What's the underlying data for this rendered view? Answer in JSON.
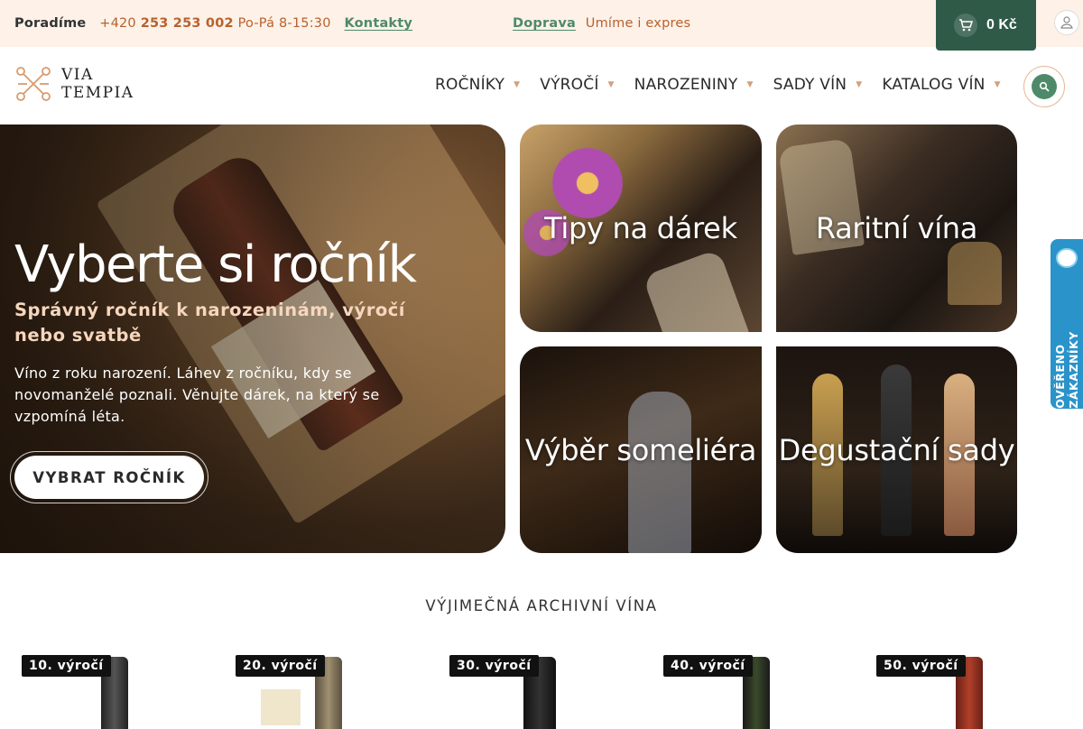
{
  "topbar": {
    "advice_label": "Poradíme",
    "phone_prefix": "+420",
    "phone_number": "253 253 002",
    "hours": "Po-Pá 8-15:30",
    "contacts_link": "Kontakty",
    "shipping_link": "Doprava",
    "shipping_text": "Umíme i expres",
    "cart_total": "0 Kč"
  },
  "header": {
    "logo_line1": "VIA",
    "logo_line2": "TEMPIA",
    "nav": [
      {
        "label": "ROČNÍKY"
      },
      {
        "label": "VÝROČÍ"
      },
      {
        "label": "NAROZENINY"
      },
      {
        "label": "SADY VÍN"
      },
      {
        "label": "KATALOG VÍN"
      }
    ]
  },
  "hero": {
    "title": "Vyberte si ročník",
    "subtitle": "Správný ročník k narozeninám, výročí nebo svatbě",
    "description": "Víno z roku narození. Láhev z ročníku, kdy se novomanželé poznali. Věnujte dárek, na který se vzpomíná léta.",
    "button": "VYBRAT ROČNÍK"
  },
  "tiles": [
    {
      "label": "Tipy na dárek"
    },
    {
      "label": "Raritní vína"
    },
    {
      "label": "Výběr someliéra"
    },
    {
      "label": "Degustační sady"
    }
  ],
  "side_badge": "OVĚŘENO ZÁKAZNÍKY",
  "archive": {
    "title": "VÝJIMEČNÁ ARCHIVNÍ VÍNA",
    "products": [
      {
        "badge": "10. výročí"
      },
      {
        "badge": "20. výročí"
      },
      {
        "badge": "30. výročí"
      },
      {
        "badge": "40. výročí"
      },
      {
        "badge": "50. výročí"
      }
    ]
  },
  "colors": {
    "topbar_bg": "#fdf1e8",
    "accent_orange": "#b8612d",
    "accent_green": "#4e8a6a",
    "cart_bg": "#2f5a48",
    "badge_blue": "#2a93c9"
  }
}
